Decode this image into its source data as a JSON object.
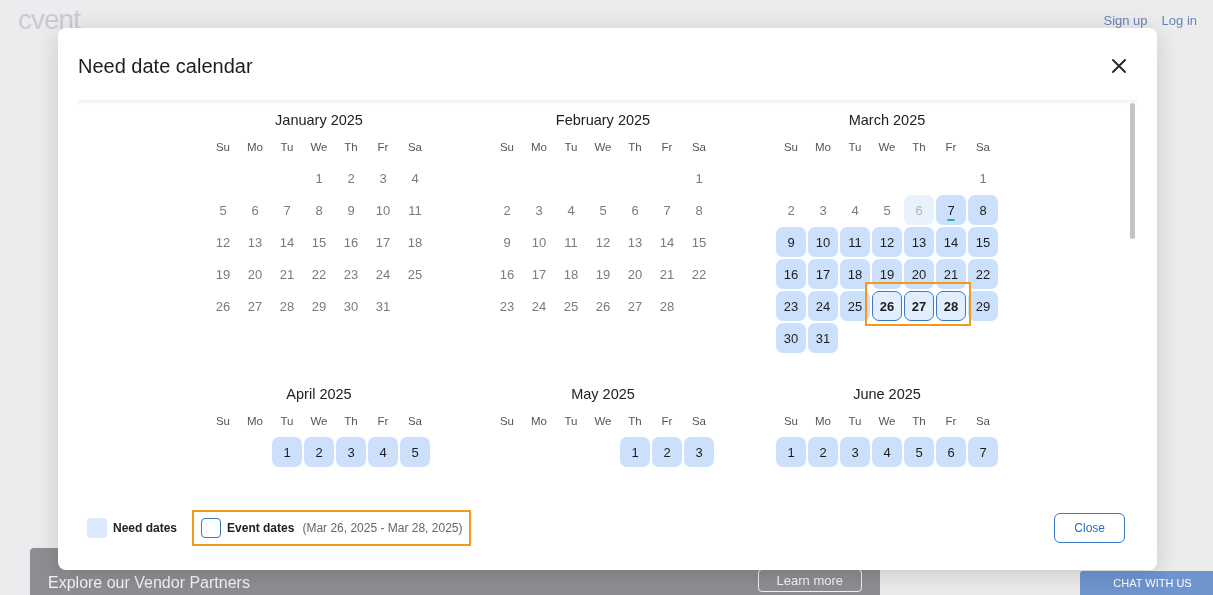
{
  "backdrop": {
    "logo": "cvent",
    "header_links": [
      "Sign up",
      "Log in"
    ],
    "banner": {
      "title": "Explore our Vendor Partners",
      "button": "Learn more"
    },
    "chat_button": "CHAT WITH US"
  },
  "dialog": {
    "title": "Need date calendar",
    "months": [
      {
        "title": "January 2025",
        "weekdays": [
          "Su",
          "Mo",
          "Tu",
          "We",
          "Th",
          "Fr",
          "Sa"
        ],
        "weeks": [
          [
            {
              "kind": "blank"
            },
            {
              "kind": "blank"
            },
            {
              "kind": "blank"
            },
            {
              "d": "1",
              "kind": "plain"
            },
            {
              "d": "2",
              "kind": "plain"
            },
            {
              "d": "3",
              "kind": "plain"
            },
            {
              "d": "4",
              "kind": "plain"
            }
          ],
          [
            {
              "d": "5",
              "kind": "plain"
            },
            {
              "d": "6",
              "kind": "plain"
            },
            {
              "d": "7",
              "kind": "plain"
            },
            {
              "d": "8",
              "kind": "plain"
            },
            {
              "d": "9",
              "kind": "plain"
            },
            {
              "d": "10",
              "kind": "plain"
            },
            {
              "d": "11",
              "kind": "plain"
            }
          ],
          [
            {
              "d": "12",
              "kind": "plain"
            },
            {
              "d": "13",
              "kind": "plain"
            },
            {
              "d": "14",
              "kind": "plain"
            },
            {
              "d": "15",
              "kind": "plain"
            },
            {
              "d": "16",
              "kind": "plain"
            },
            {
              "d": "17",
              "kind": "plain"
            },
            {
              "d": "18",
              "kind": "plain"
            }
          ],
          [
            {
              "d": "19",
              "kind": "plain"
            },
            {
              "d": "20",
              "kind": "plain"
            },
            {
              "d": "21",
              "kind": "plain"
            },
            {
              "d": "22",
              "kind": "plain"
            },
            {
              "d": "23",
              "kind": "plain"
            },
            {
              "d": "24",
              "kind": "plain"
            },
            {
              "d": "25",
              "kind": "plain"
            }
          ],
          [
            {
              "d": "26",
              "kind": "plain"
            },
            {
              "d": "27",
              "kind": "plain"
            },
            {
              "d": "28",
              "kind": "plain"
            },
            {
              "d": "29",
              "kind": "plain"
            },
            {
              "d": "30",
              "kind": "plain"
            },
            {
              "d": "31",
              "kind": "plain"
            }
          ]
        ]
      },
      {
        "title": "February 2025",
        "weekdays": [
          "Su",
          "Mo",
          "Tu",
          "We",
          "Th",
          "Fr",
          "Sa"
        ],
        "weeks": [
          [
            {
              "kind": "blank"
            },
            {
              "kind": "blank"
            },
            {
              "kind": "blank"
            },
            {
              "kind": "blank"
            },
            {
              "kind": "blank"
            },
            {
              "kind": "blank"
            },
            {
              "d": "1",
              "kind": "plain"
            }
          ],
          [
            {
              "d": "2",
              "kind": "plain"
            },
            {
              "d": "3",
              "kind": "plain"
            },
            {
              "d": "4",
              "kind": "plain"
            },
            {
              "d": "5",
              "kind": "plain"
            },
            {
              "d": "6",
              "kind": "plain"
            },
            {
              "d": "7",
              "kind": "plain"
            },
            {
              "d": "8",
              "kind": "plain"
            }
          ],
          [
            {
              "d": "9",
              "kind": "plain"
            },
            {
              "d": "10",
              "kind": "plain"
            },
            {
              "d": "11",
              "kind": "plain"
            },
            {
              "d": "12",
              "kind": "plain"
            },
            {
              "d": "13",
              "kind": "plain"
            },
            {
              "d": "14",
              "kind": "plain"
            },
            {
              "d": "15",
              "kind": "plain"
            }
          ],
          [
            {
              "d": "16",
              "kind": "plain"
            },
            {
              "d": "17",
              "kind": "plain"
            },
            {
              "d": "18",
              "kind": "plain"
            },
            {
              "d": "19",
              "kind": "plain"
            },
            {
              "d": "20",
              "kind": "plain"
            },
            {
              "d": "21",
              "kind": "plain"
            },
            {
              "d": "22",
              "kind": "plain"
            }
          ],
          [
            {
              "d": "23",
              "kind": "plain"
            },
            {
              "d": "24",
              "kind": "plain"
            },
            {
              "d": "25",
              "kind": "plain"
            },
            {
              "d": "26",
              "kind": "plain"
            },
            {
              "d": "27",
              "kind": "plain"
            },
            {
              "d": "28",
              "kind": "plain"
            }
          ]
        ]
      },
      {
        "title": "March 2025",
        "weekdays": [
          "Su",
          "Mo",
          "Tu",
          "We",
          "Th",
          "Fr",
          "Sa"
        ],
        "weeks": [
          [
            {
              "kind": "blank"
            },
            {
              "kind": "blank"
            },
            {
              "kind": "blank"
            },
            {
              "kind": "blank"
            },
            {
              "kind": "blank"
            },
            {
              "kind": "blank"
            },
            {
              "d": "1",
              "kind": "plain"
            }
          ],
          [
            {
              "d": "2",
              "kind": "plain"
            },
            {
              "d": "3",
              "kind": "plain"
            },
            {
              "d": "4",
              "kind": "plain"
            },
            {
              "d": "5",
              "kind": "plain"
            },
            {
              "d": "6",
              "kind": "unavailable"
            },
            {
              "d": "7",
              "kind": "today"
            },
            {
              "d": "8",
              "kind": "need"
            }
          ],
          [
            {
              "d": "9",
              "kind": "need"
            },
            {
              "d": "10",
              "kind": "need"
            },
            {
              "d": "11",
              "kind": "need"
            },
            {
              "d": "12",
              "kind": "need"
            },
            {
              "d": "13",
              "kind": "need"
            },
            {
              "d": "14",
              "kind": "need"
            },
            {
              "d": "15",
              "kind": "need"
            }
          ],
          [
            {
              "d": "16",
              "kind": "need"
            },
            {
              "d": "17",
              "kind": "need"
            },
            {
              "d": "18",
              "kind": "need"
            },
            {
              "d": "19",
              "kind": "need"
            },
            {
              "d": "20",
              "kind": "need"
            },
            {
              "d": "21",
              "kind": "need"
            },
            {
              "d": "22",
              "kind": "need"
            }
          ],
          [
            {
              "d": "23",
              "kind": "need"
            },
            {
              "d": "24",
              "kind": "need"
            },
            {
              "d": "25",
              "kind": "need"
            },
            {
              "d": "26",
              "kind": "event"
            },
            {
              "d": "27",
              "kind": "event"
            },
            {
              "d": "28",
              "kind": "event"
            },
            {
              "d": "29",
              "kind": "need"
            }
          ],
          [
            {
              "d": "30",
              "kind": "need"
            },
            {
              "d": "31",
              "kind": "need"
            }
          ]
        ]
      },
      {
        "title": "April 2025",
        "weekdays": [
          "Su",
          "Mo",
          "Tu",
          "We",
          "Th",
          "Fr",
          "Sa"
        ],
        "weeks": [
          [
            {
              "kind": "blank"
            },
            {
              "kind": "blank"
            },
            {
              "d": "1",
              "kind": "need"
            },
            {
              "d": "2",
              "kind": "need"
            },
            {
              "d": "3",
              "kind": "need"
            },
            {
              "d": "4",
              "kind": "need"
            },
            {
              "d": "5",
              "kind": "need"
            }
          ]
        ]
      },
      {
        "title": "May 2025",
        "weekdays": [
          "Su",
          "Mo",
          "Tu",
          "We",
          "Th",
          "Fr",
          "Sa"
        ],
        "weeks": [
          [
            {
              "kind": "blank"
            },
            {
              "kind": "blank"
            },
            {
              "kind": "blank"
            },
            {
              "kind": "blank"
            },
            {
              "d": "1",
              "kind": "need"
            },
            {
              "d": "2",
              "kind": "need"
            },
            {
              "d": "3",
              "kind": "need"
            }
          ]
        ]
      },
      {
        "title": "June 2025",
        "weekdays": [
          "Su",
          "Mo",
          "Tu",
          "We",
          "Th",
          "Fr",
          "Sa"
        ],
        "weeks": [
          [
            {
              "d": "1",
              "kind": "need"
            },
            {
              "d": "2",
              "kind": "need"
            },
            {
              "d": "3",
              "kind": "need"
            },
            {
              "d": "4",
              "kind": "need"
            },
            {
              "d": "5",
              "kind": "need"
            },
            {
              "d": "6",
              "kind": "need"
            },
            {
              "d": "7",
              "kind": "need"
            }
          ]
        ]
      }
    ],
    "event_range_highlighted": true,
    "legend": [
      {
        "kind": "need",
        "label": "Need dates",
        "highlighted": false
      },
      {
        "kind": "event",
        "label": "Event dates",
        "range": "(Mar 26, 2025 - Mar 28, 2025)",
        "highlighted": true
      }
    ],
    "close_button": "Close"
  }
}
